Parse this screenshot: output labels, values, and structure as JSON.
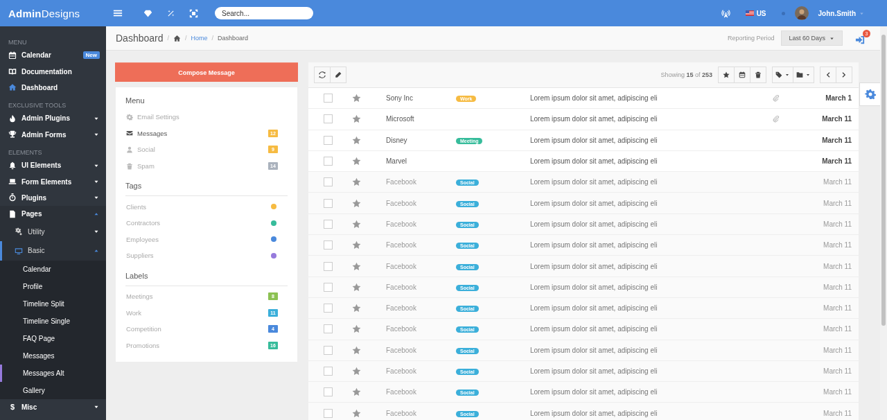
{
  "header": {
    "brand": "**Admin**Designs",
    "search": {
      "placeholder": "Search..."
    },
    "language": "US",
    "user": "John.Smith"
  },
  "sidebar": {
    "sections": [
      {
        "heading": "MENU",
        "items": [
          {
            "label": "Calendar",
            "badge": "New",
            "selected": false
          },
          {
            "label": "Documentation",
            "selected": false
          },
          {
            "label": "Dashboard",
            "selected": true
          }
        ]
      },
      {
        "heading": "EXCLUSIVE TOOLS",
        "items": [
          {
            "label": "Admin Plugins",
            "expanded": false,
            "selected": false
          },
          {
            "label": "Admin Forms",
            "expanded": false,
            "selected": false
          }
        ]
      },
      {
        "heading": "ELEMENTS",
        "items": [
          {
            "label": "UI Elements",
            "expanded": false,
            "selected": false
          },
          {
            "label": "Form Elements",
            "expanded": false,
            "selected": false
          },
          {
            "label": "Plugins",
            "expanded": false,
            "selected": false
          },
          {
            "label": "Pages",
            "expanded": true,
            "selected": false,
            "children": [
              {
                "label": "Utility",
                "expanded": false,
                "selected": false
              },
              {
                "label": "Basic",
                "expanded": true,
                "selected": true,
                "children": [
                  {
                    "label": "Calendar",
                    "selected": false
                  },
                  {
                    "label": "Profile",
                    "selected": false
                  },
                  {
                    "label": "Timeline Split",
                    "selected": false
                  },
                  {
                    "label": "Timeline Single",
                    "selected": false
                  },
                  {
                    "label": "FAQ Page",
                    "selected": false
                  },
                  {
                    "label": "Messages",
                    "selected": false
                  },
                  {
                    "label": "Messages Alt",
                    "selected": true
                  },
                  {
                    "label": "Gallery",
                    "selected": false
                  }
                ]
              }
            ]
          },
          {
            "label": "Misc",
            "glyph": "$",
            "expanded": false,
            "selected": false
          }
        ]
      }
    ]
  },
  "breadcrumb": {
    "title": "Dashboard",
    "separator": "/",
    "links": [
      "Home",
      "Dashboard"
    ],
    "period_label": "Reporting Period",
    "period": "Last 60 Days",
    "notifications": "3"
  },
  "compose_button": "Compose Message",
  "folders": {
    "heading": "Menu",
    "items": [
      {
        "label": "Email Settings",
        "selected": false
      },
      {
        "label": "Messages",
        "count": "12",
        "color": "#f6bb42",
        "selected": true
      },
      {
        "label": "Social",
        "count": "9",
        "color": "#f6bb42",
        "selected": false
      },
      {
        "label": "Spam",
        "count": "14",
        "color": "#aab2bd",
        "selected": false
      }
    ]
  },
  "tags": {
    "heading": "Tags",
    "items": [
      {
        "label": "Clients",
        "color": "#f6bb42"
      },
      {
        "label": "Contractors",
        "color": "#37bc9b"
      },
      {
        "label": "Employees",
        "color": "#4a89dc"
      },
      {
        "label": "Suppliers",
        "color": "#967adc"
      }
    ]
  },
  "labels": {
    "heading": "Labels",
    "items": [
      {
        "label": "Meetings",
        "count": "8",
        "color": "#8cc152"
      },
      {
        "label": "Work",
        "count": "11",
        "color": "#3bafda"
      },
      {
        "label": "Competition",
        "count": "4",
        "color": "#4a89dc"
      },
      {
        "label": "Promotions",
        "count": "16",
        "color": "#37bc9b"
      }
    ]
  },
  "toolbar": {
    "showing": "Showing **15** of **253**"
  },
  "messages": [
    {
      "sender": "Sony Inc",
      "tag": {
        "label": "Work",
        "color": "#f6bb42"
      },
      "subject": "Lorem ipsum dolor sit amet, adipiscing eli",
      "attachment": true,
      "date": "March 1",
      "unread": true,
      "checked": false
    },
    {
      "sender": "Microsoft",
      "subject": "Lorem ipsum dolor sit amet, adipiscing eli",
      "attachment": true,
      "date": "March 11",
      "unread": true,
      "checked": false
    },
    {
      "sender": "Disney",
      "tag": {
        "label": "Meeting",
        "color": "#37bc9b"
      },
      "subject": "Lorem ipsum dolor sit amet, adipiscing eli",
      "attachment": false,
      "date": "March 11",
      "unread": true,
      "checked": false
    },
    {
      "sender": "Marvel",
      "subject": "Lorem ipsum dolor sit amet, adipiscing eli",
      "attachment": false,
      "date": "March 11",
      "unread": true,
      "checked": false
    },
    {
      "sender": "Facebook",
      "tag": {
        "label": "Social",
        "color": "#3bafda"
      },
      "subject": "Lorem ipsum dolor sit amet, adipiscing eli",
      "attachment": false,
      "date": "March 11",
      "unread": false,
      "checked": false
    },
    {
      "sender": "Facebook",
      "tag": {
        "label": "Social",
        "color": "#3bafda"
      },
      "subject": "Lorem ipsum dolor sit amet, adipiscing eli",
      "attachment": false,
      "date": "March 11",
      "unread": false,
      "checked": false
    },
    {
      "sender": "Facebook",
      "tag": {
        "label": "Social",
        "color": "#3bafda"
      },
      "subject": "Lorem ipsum dolor sit amet, adipiscing eli",
      "attachment": false,
      "date": "March 11",
      "unread": false,
      "checked": false
    },
    {
      "sender": "Facebook",
      "tag": {
        "label": "Social",
        "color": "#3bafda"
      },
      "subject": "Lorem ipsum dolor sit amet, adipiscing eli",
      "attachment": false,
      "date": "March 11",
      "unread": false,
      "checked": false
    },
    {
      "sender": "Facebook",
      "tag": {
        "label": "Social",
        "color": "#3bafda"
      },
      "subject": "Lorem ipsum dolor sit amet, adipiscing eli",
      "attachment": false,
      "date": "March 11",
      "unread": false,
      "checked": false
    },
    {
      "sender": "Facebook",
      "tag": {
        "label": "Social",
        "color": "#3bafda"
      },
      "subject": "Lorem ipsum dolor sit amet, adipiscing eli",
      "attachment": false,
      "date": "March 11",
      "unread": false,
      "checked": false
    },
    {
      "sender": "Facebook",
      "tag": {
        "label": "Social",
        "color": "#3bafda"
      },
      "subject": "Lorem ipsum dolor sit amet, adipiscing eli",
      "attachment": false,
      "date": "March 11",
      "unread": false,
      "checked": false
    },
    {
      "sender": "Facebook",
      "tag": {
        "label": "Social",
        "color": "#3bafda"
      },
      "subject": "Lorem ipsum dolor sit amet, adipiscing eli",
      "attachment": false,
      "date": "March 11",
      "unread": false,
      "checked": false
    },
    {
      "sender": "Facebook",
      "tag": {
        "label": "Social",
        "color": "#3bafda"
      },
      "subject": "Lorem ipsum dolor sit amet, adipiscing eli",
      "attachment": false,
      "date": "March 11",
      "unread": false,
      "checked": false
    },
    {
      "sender": "Facebook",
      "tag": {
        "label": "Social",
        "color": "#3bafda"
      },
      "subject": "Lorem ipsum dolor sit amet, adipiscing eli",
      "attachment": false,
      "date": "March 11",
      "unread": false,
      "checked": false
    },
    {
      "sender": "Facebook",
      "tag": {
        "label": "Social",
        "color": "#3bafda"
      },
      "subject": "Lorem ipsum dolor sit amet, adipiscing eli",
      "attachment": false,
      "date": "March 11",
      "unread": false,
      "checked": false
    },
    {
      "sender": "Facebook",
      "tag": {
        "label": "Social",
        "color": "#3bafda"
      },
      "subject": "Lorem ipsum dolor sit amet, adipiscing eli",
      "attachment": false,
      "date": "March 11",
      "unread": false,
      "checked": false
    }
  ]
}
